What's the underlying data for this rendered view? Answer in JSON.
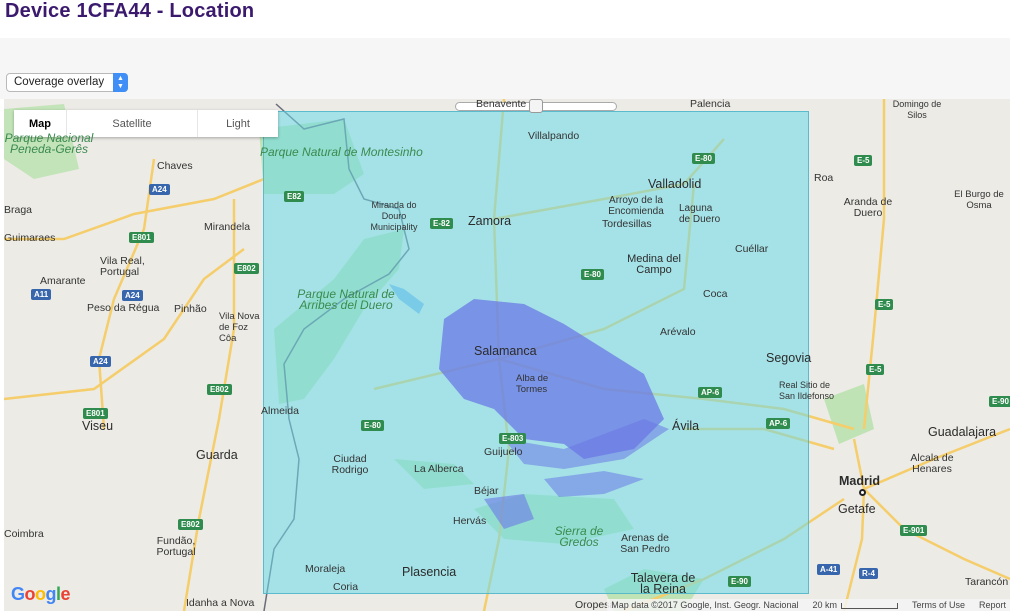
{
  "page": {
    "title": "Device 1CFA44 - Location"
  },
  "overlay_select": {
    "value": "Coverage overlay"
  },
  "map_type": {
    "buttons": [
      "Map",
      "Satellite",
      "Light"
    ],
    "selected": "Map"
  },
  "colors": {
    "title": "#3b1a6e",
    "coverage": "#6bdae8",
    "coverage_signal": "#6b78e6",
    "select_accent": "#3f8ff7"
  },
  "map": {
    "cities": [
      "Salamanca",
      "Valladolid",
      "Zamora",
      "Madrid",
      "Segovia",
      "Ávila",
      "Palencia",
      "Benavente",
      "Viseu",
      "Guarda",
      "Chaves",
      "Plasencia",
      "Béjar",
      "Guadalajara",
      "Getafe",
      "Talavera de la Reina",
      "Vila Real, Portugal"
    ],
    "towns": [
      "Villalpando",
      "Arroyo de la Encomienda",
      "Laguna de Duero",
      "Tordesillas",
      "Medina del Campo",
      "Cuéllar",
      "Coca",
      "Arévalo",
      "Real Sitio de San Ildefonso",
      "Alba de Tormes",
      "Guijuelo",
      "Ciudad Rodrigo",
      "La Alberca",
      "Hervás",
      "Arenas de San Pedro",
      "Moraleja",
      "Coria",
      "Almeida",
      "Miranda do Douro Municipality",
      "Mirandela",
      "Amarante",
      "Peso da Régua",
      "Pinhão",
      "Vila Nova de Foz Côa",
      "Fundão, Portugal",
      "Domingo de Silos",
      "Roa",
      "Aranda de Duero",
      "El Burgo de Osma",
      "Alcala de Henares",
      "Tarancón",
      "Guimaraes",
      "Idanha a Nova",
      "Oropesa",
      "Braga",
      "Coimbra"
    ],
    "parks": [
      "Parque Natural de Montesinho",
      "Parque Natural de Arribes del Duero",
      "Sierra de Gredos",
      "Parque Nacional Peneda-Gerês"
    ],
    "roads": [
      "E82",
      "E-82",
      "E-80",
      "A24",
      "A11",
      "E801",
      "E802",
      "E-803",
      "E-5",
      "AP-6",
      "E-90",
      "E-901",
      "A-41",
      "R-4"
    ]
  },
  "attribution": {
    "google": "Google",
    "map_data": "Map data ©2017 Google, Inst. Geogr. Nacional",
    "scale": "20 km",
    "terms": "Terms of Use",
    "report": "Report"
  }
}
